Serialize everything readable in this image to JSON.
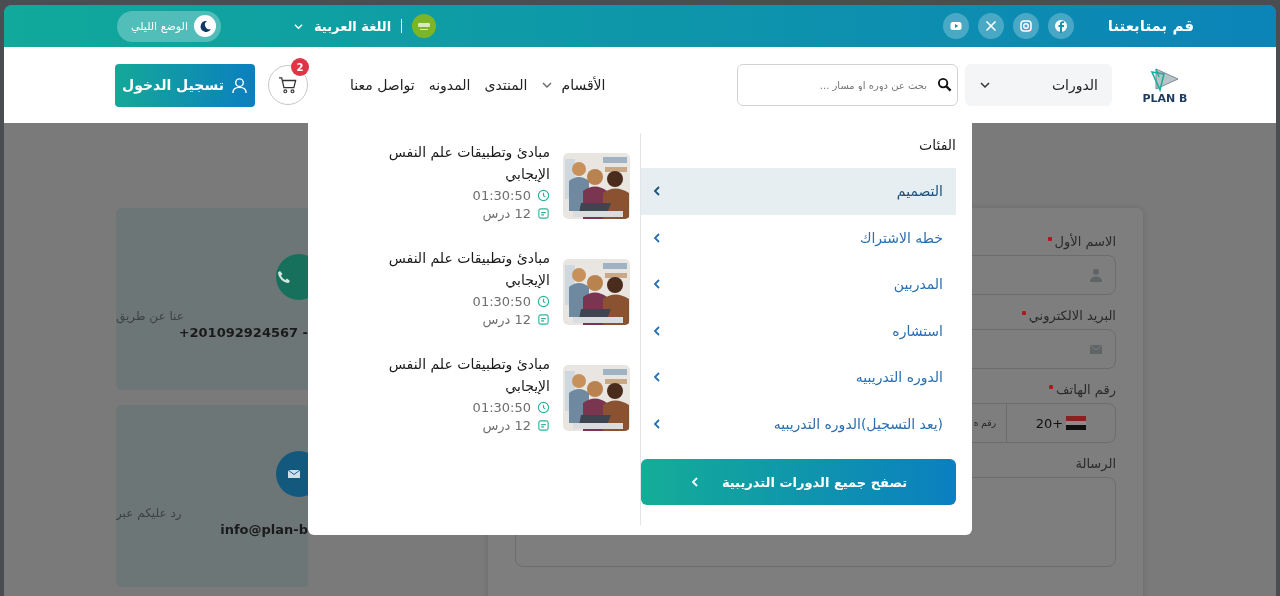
{
  "top_bar": {
    "follow_label": "قم بمتابعتنا",
    "social": [
      {
        "kind": "facebook"
      },
      {
        "kind": "instagram"
      },
      {
        "kind": "x"
      },
      {
        "kind": "youtube"
      }
    ],
    "language": "اللغة العربية",
    "night_mode": "الوضع الليلي"
  },
  "header": {
    "logo": "PLAN B",
    "courses_dropdown": "الدورات",
    "search": {
      "placeholder": "بحث عن دوره او مسار ..."
    },
    "nav": [
      {
        "label": "الأقسام",
        "dropdown": true
      },
      {
        "label": "المنتدى",
        "dropdown": false
      },
      {
        "label": "المدونه",
        "dropdown": false
      },
      {
        "label": "تواصل معنا",
        "dropdown": false
      }
    ],
    "cart_count": "2",
    "login": "تسجيل الدخول"
  },
  "contact_cards": [
    {
      "kind": "phone",
      "text": "عنا عن طريق",
      "value": "+201092924567  -"
    },
    {
      "kind": "email",
      "text": "رد عليكم عبر",
      "value": "info@plan-b"
    }
  ],
  "form": {
    "fields": [
      {
        "kind": "name",
        "label": "الاسم الأول",
        "required": true
      },
      {
        "kind": "email",
        "label": "البريد الالكتروني",
        "required": true
      },
      {
        "kind": "phone",
        "label": "رقم الهاتف",
        "required": true,
        "country_code": "+20",
        "placeholder": "رقم ه"
      },
      {
        "kind": "message",
        "label": "الرسالة",
        "required": false
      }
    ]
  },
  "mega_menu": {
    "categories_title": "الفئات",
    "categories": [
      {
        "label": "التصميم",
        "selected": true
      },
      {
        "label": "خطه الاشتراك",
        "selected": false
      },
      {
        "label": "المدربين",
        "selected": false
      },
      {
        "label": "استشاره",
        "selected": false
      },
      {
        "label": "الدوره التدريبيه",
        "selected": false
      },
      {
        "label": "(يعد التسجيل)الدوره التدريبيه",
        "selected": false
      }
    ],
    "browse_all": "تصفح جميع الدورات التدريبية",
    "courses": [
      {
        "title": "مبادئ وتطبيقات علم النفس الإيجابي",
        "duration": "01:30:50",
        "lessons": "12 درس"
      },
      {
        "title": "مبادئ وتطبيقات علم النفس الإيجابي",
        "duration": "01:30:50",
        "lessons": "12 درس"
      },
      {
        "title": "مبادئ وتطبيقات علم النفس الإيجابي",
        "duration": "01:30:50",
        "lessons": "12 درس"
      }
    ]
  }
}
